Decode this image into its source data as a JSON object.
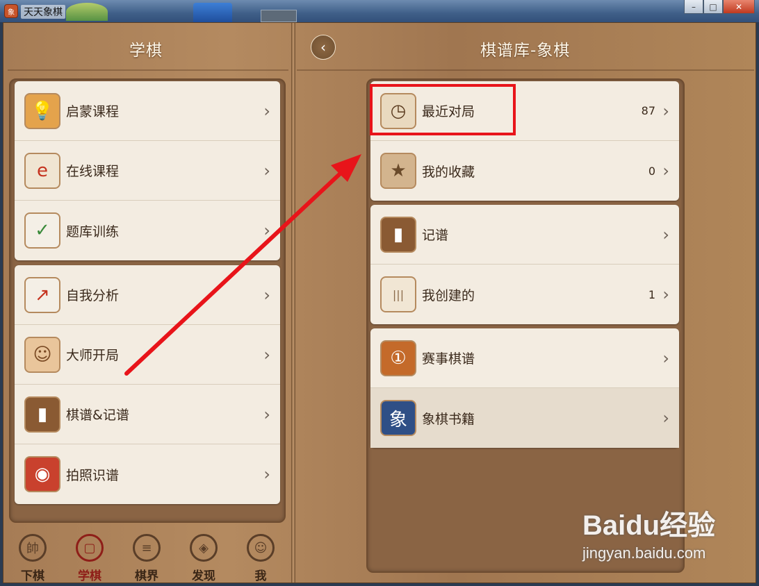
{
  "window": {
    "title": "天天象棋",
    "app_icon": "chess-app-icon",
    "buttons": {
      "minimize": "–",
      "maximize": "□",
      "close": "✕"
    }
  },
  "left": {
    "header": "学棋",
    "groups": [
      [
        {
          "label": "启蒙课程",
          "icon": "lightbulb-icon"
        },
        {
          "label": "在线课程",
          "icon": "browser-e-icon"
        },
        {
          "label": "题库训练",
          "icon": "quiz-pad-icon"
        }
      ],
      [
        {
          "label": "自我分析",
          "icon": "analysis-chart-icon"
        },
        {
          "label": "大师开局",
          "icon": "master-face-icon"
        },
        {
          "label": "棋谱&记谱",
          "icon": "notebook-icon"
        },
        {
          "label": "拍照识谱",
          "icon": "camera-icon"
        }
      ]
    ]
  },
  "right": {
    "header": "棋谱库-象棋",
    "groups": [
      [
        {
          "label": "最近对局",
          "count": "87",
          "icon": "clock-icon"
        },
        {
          "label": "我的收藏",
          "count": "0",
          "icon": "star-icon"
        }
      ],
      [
        {
          "label": "记谱",
          "count": "",
          "icon": "notebook-icon"
        },
        {
          "label": "我创建的",
          "count": "1",
          "icon": "board-lines-icon"
        }
      ],
      [
        {
          "label": "赛事棋谱",
          "count": "",
          "icon": "medal-icon"
        },
        {
          "label": "象棋书籍",
          "count": "",
          "icon": "book-icon"
        }
      ]
    ]
  },
  "nav": [
    {
      "label": "下棋",
      "glyph": "帥",
      "icon": "play-chess-icon"
    },
    {
      "label": "学棋",
      "glyph": "▢",
      "icon": "learn-book-icon",
      "active": true
    },
    {
      "label": "棋界",
      "glyph": "≡",
      "icon": "chat-bubble-icon"
    },
    {
      "label": "发现",
      "glyph": "◈",
      "icon": "compass-icon"
    },
    {
      "label": "我",
      "glyph": "☺",
      "icon": "person-icon"
    }
  ],
  "chevron": "›",
  "back_glyph": "‹",
  "watermark": {
    "main": "Baidu经验",
    "sub": "jingyan.baidu.com"
  },
  "colors": {
    "annotation_red": "#e8141a",
    "active_nav": "#8e1e18"
  }
}
